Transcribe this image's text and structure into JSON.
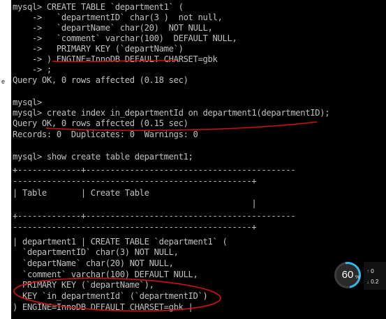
{
  "sidebar": {
    "fragments": [
      "e"
    ]
  },
  "terminal": {
    "lines": [
      "mysql> CREATE TABLE `department1` (",
      "    ->   `departmentID` char(3 )  not null,",
      "    ->   `departName` char(20)  NOT NULL,",
      "    ->   `comment` varchar(100)  DEFAULT NULL,",
      "    ->   PRIMARY KEY (`departName`)",
      "    -> ) ENGINE=InnoDB DEFAULT CHARSET=gbk",
      "    -> ;",
      "Query OK, 0 rows affected (0.18 sec)",
      "",
      "mysql>",
      "mysql> create index in_departmentId on department1(departmentID);",
      "Query OK, 0 rows affected (0.15 sec)",
      "Records: 0  Duplicates: 0  Warnings: 0",
      "",
      "mysql> show create table department1;",
      "+-------------+-------------------------------------------",
      "-------------------------------------------------+",
      "| Table       | Create Table",
      "                                                 |",
      "+-------------+-------------------------------------------",
      "-------------------------------------------------+",
      "| department1 | CREATE TABLE `department1` (",
      "  `departmentID` char(3) NOT NULL,",
      "  `departName` char(20) NOT NULL,",
      "  `comment` varchar(100) DEFAULT NULL,",
      "  PRIMARY KEY (`departName`),",
      "  KEY `in_departmentId` (`departmentID`)",
      ") ENGINE=InnoDB DEFAULT CHARSET=gbk |"
    ]
  },
  "monitor": {
    "cpu_value": "60",
    "cpu_unit": "%",
    "upload": "0",
    "download": "0.2",
    "ring_color": "#2fb8e8"
  },
  "annotation_color": "#d21010"
}
